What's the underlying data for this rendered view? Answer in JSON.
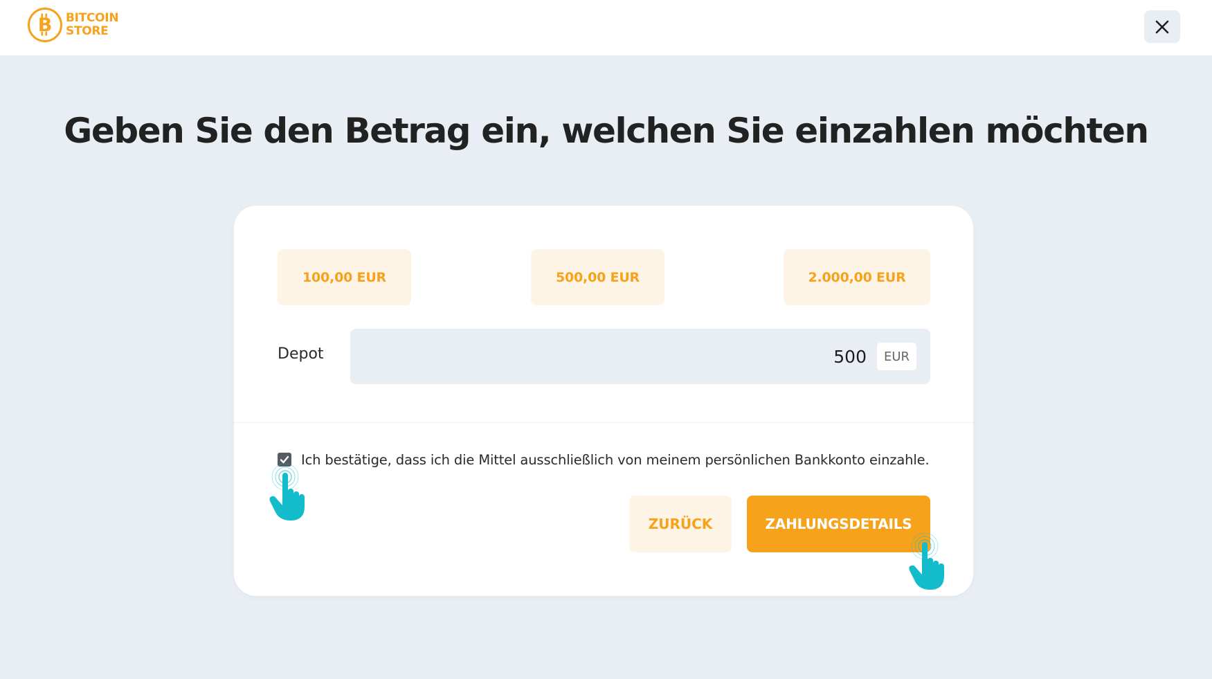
{
  "header": {
    "logo": {
      "line1": "BITCOIN",
      "line2": "STORE",
      "icon": "bitcoin-coin-icon"
    },
    "close_icon": "close-icon"
  },
  "page": {
    "title": "Geben Sie den Betrag ein, welchen Sie einzahlen möchten"
  },
  "presets": [
    {
      "label": "100,00 EUR"
    },
    {
      "label": "500,00 EUR"
    },
    {
      "label": "2.000,00 EUR"
    }
  ],
  "deposit": {
    "label": "Depot",
    "value": "500",
    "currency": "EUR"
  },
  "confirmation": {
    "checked": true,
    "text": "Ich bestätige, dass ich die Mittel ausschließlich von meinem persönlichen Bankkonto einzahle."
  },
  "actions": {
    "back_label": "ZURÜCK",
    "next_label": "ZAHLUNGSDETAILS"
  },
  "colors": {
    "accent": "#f7a21b",
    "accent_soft": "#fef4e6",
    "background": "#e8eef4",
    "pointer_hand": "#12bccb"
  },
  "overlays": {
    "pointer_icon": "pointer-hand-icon"
  }
}
